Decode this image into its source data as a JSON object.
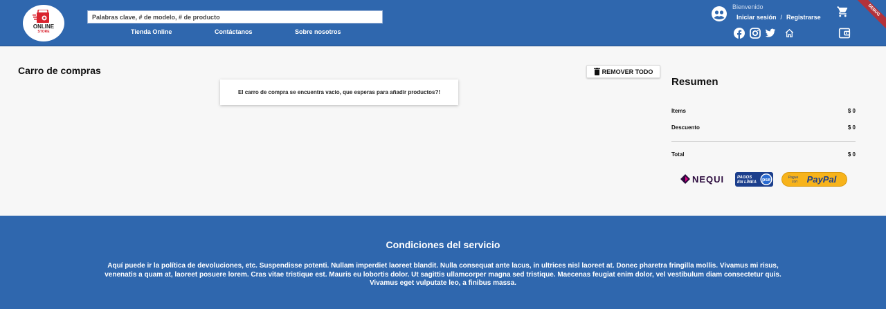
{
  "header": {
    "logo": {
      "title": "ONLINE",
      "subtitle": "STORE"
    },
    "search": {
      "placeholder": "Palabras clave, # de modelo, # de producto"
    },
    "nav": [
      "Tienda Online",
      "Contáctanos",
      "Sobre nosotros"
    ],
    "user": {
      "greeting": "Bienvenido",
      "login": "Iniciar sesión",
      "separator": "/",
      "register": "Registrarse"
    },
    "icons": [
      "account-icon",
      "cart-icon",
      "facebook-icon",
      "instagram-icon",
      "twitter-icon",
      "home-icon",
      "wallet-icon"
    ],
    "debug_banner": "DEBUG"
  },
  "cart": {
    "title": "Carro de compras",
    "remove_all_label": "REMOVER TODO",
    "empty_message": "El carro de compra se encuentra vacio, que esperas para añadir productos?!"
  },
  "summary": {
    "title": "Resumen",
    "rows": [
      {
        "label": "Items",
        "value": "$ 0"
      },
      {
        "label": "Descuento",
        "value": "$ 0"
      }
    ],
    "total": {
      "label": "Total",
      "value": "$ 0"
    },
    "payment_methods": {
      "nequi": "NEQUI",
      "pse_line1": "PAGOS",
      "pse_line2": "EN LÍNEA",
      "pse_badge": "pse",
      "paypal_prefix_1": "Pague",
      "paypal_prefix_2": "con",
      "paypal_brand": "PayPal"
    }
  },
  "footer": {
    "title": "Condiciones del servicio",
    "text": "Aquí puede ir la política de devoluciones, etc. Suspendisse potenti. Nullam imperdiet laoreet blandit. Nulla consequat ante lacus, in ultrices nisl laoreet at. Donec pharetra fringilla mollis. Vivamus mi risus, venenatis a quam at, laoreet posuere lorem. Cras vitae tristique est. Mauris eu lobortis dolor. Ut sagittis ullamcorper magna sed tristique. Maecenas feugiat enim dolor, vel vestibulum diam consectetur quis. Vivamus eget vulputate leo, a finibus massa."
  },
  "colors": {
    "brand_blue": "#2f67ae",
    "logo_red": "#d9232e",
    "paypal_yellow": "#f7b31b"
  }
}
